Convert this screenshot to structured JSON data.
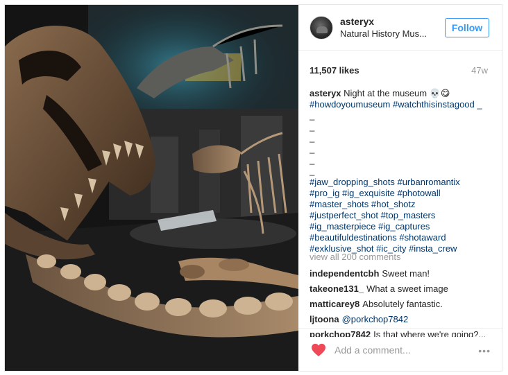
{
  "post": {
    "image_alt": "Dinosaur skeletons in museum hall",
    "header": {
      "username": "asteryx",
      "location": "Natural History Mus...",
      "follow_label": "Follow"
    },
    "likes": "11,507 likes",
    "time": "47w",
    "caption": {
      "username": "asteryx",
      "text": " Night at the museum 💀😋",
      "line2_tags": "#howdoyoumuseum #watchthisinstagood _",
      "dashes": [
        "_",
        "_",
        "_",
        "_",
        "_",
        "_"
      ],
      "hashtag_lines": [
        "#jaw_dropping_shots #urbanromantix",
        "#pro_ig #ig_exquisite #photowall",
        "#master_shots #hot_shotz",
        "#justperfect_shot #top_masters",
        "#ig_masterpiece #ig_captures",
        "#beautifuldestinations #shotaward",
        "#exklusive_shot #ic_city #insta_crew"
      ]
    },
    "view_all": "view all 200 comments",
    "comments": [
      {
        "user": "independentcbh",
        "text": "Sweet man!"
      },
      {
        "user": "takeone131_",
        "text": "What a sweet image"
      },
      {
        "user": "matticarey8",
        "text": "Absolutely fantastic."
      },
      {
        "user": "ljtoona",
        "mention": "@porkchop7842"
      },
      {
        "user": "porkchop7842",
        "text": "Is that where we're going?..."
      }
    ],
    "add_comment_placeholder": "Add a comment...",
    "more_label": "•••",
    "colors": {
      "accent": "#3897f0",
      "tag": "#003569",
      "heart": "#ed4956",
      "muted": "#999999"
    },
    "icons": {
      "like": "heart-icon",
      "more": "more-options-icon"
    }
  }
}
